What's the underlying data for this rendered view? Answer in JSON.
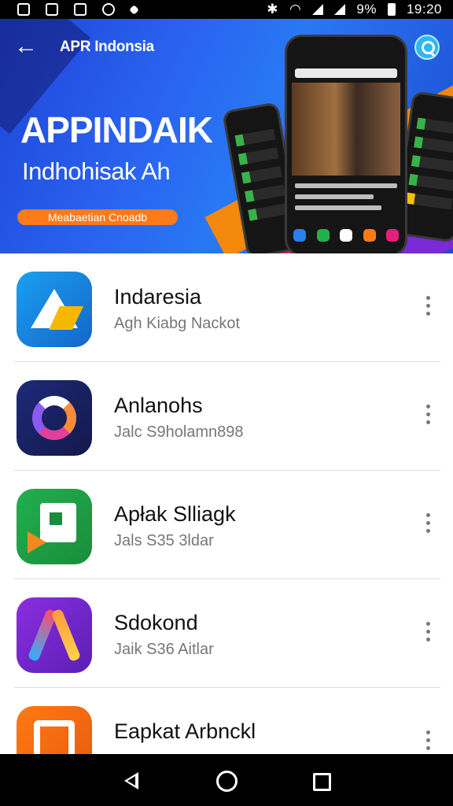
{
  "status_bar": {
    "battery_text": "9%",
    "time": "19:20",
    "icons": [
      "gallery-icon",
      "image-icon",
      "sim-icon",
      "data-saver-icon",
      "notification-dot-icon",
      "bluetooth-icon",
      "wifi-icon",
      "signal-icon",
      "signal-icon-2",
      "battery-icon"
    ]
  },
  "banner": {
    "brand": "APR Indonsia",
    "title": "APPINDAIK",
    "subtitle": "Indhohisak Ah",
    "pill": "Meabaetian Cnoadb",
    "colors": {
      "background": "#2a63f0",
      "pill": "#ff7a18",
      "search": "#2fb6f5"
    }
  },
  "apps": [
    {
      "name": "Indaresia",
      "subtitle": "Agh Kiabg Nackot",
      "icon": "triangle-logo-icon",
      "color": "#1a8ff0"
    },
    {
      "name": "Anlanohs",
      "subtitle": "Jalc S9holamn898",
      "icon": "ring-logo-icon",
      "color": "#1c2a78"
    },
    {
      "name": "Apłak Slliagk",
      "subtitle": "Jals S35 3ldar",
      "icon": "document-play-icon",
      "color": "#22b04e"
    },
    {
      "name": "Sdokond",
      "subtitle": "Jaik S36 Aitlar",
      "icon": "a-letter-logo-icon",
      "color": "#8b2ee0"
    },
    {
      "name": "Eapkat Arbnckl",
      "subtitle": "",
      "icon": "frame-logo-icon",
      "color": "#ff7a14"
    }
  ],
  "nav_bar": {
    "buttons": [
      "back-icon",
      "home-icon",
      "recents-icon"
    ]
  }
}
